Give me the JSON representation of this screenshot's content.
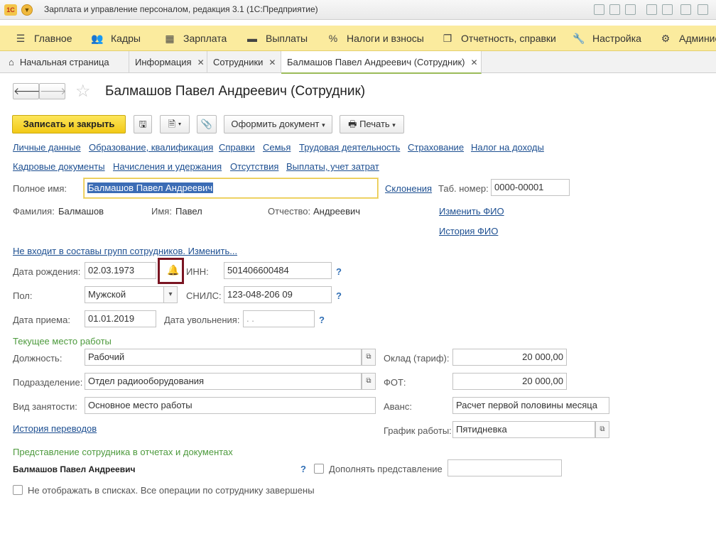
{
  "window": {
    "logo": "1С",
    "title": "Зарплата и управление персоналом, редакция 3.1  (1С:Предприятие)"
  },
  "main_menu": [
    {
      "icon": "hamburger-icon",
      "label": "Главное"
    },
    {
      "icon": "people-icon",
      "label": "Кадры"
    },
    {
      "icon": "calculator-icon",
      "label": "Зарплата"
    },
    {
      "icon": "wallet-icon",
      "label": "Выплаты"
    },
    {
      "icon": "percent-icon",
      "label": "Налоги и взносы"
    },
    {
      "icon": "reports-icon",
      "label": "Отчетность, справки"
    },
    {
      "icon": "wrench-icon",
      "label": "Настройка"
    },
    {
      "icon": "gear-icon",
      "label": "Админис"
    }
  ],
  "tabs": [
    {
      "label": "Начальная страница"
    },
    {
      "label": "Информация",
      "close": "✕"
    },
    {
      "label": "Сотрудники",
      "close": "✕"
    },
    {
      "label": "Балмашов Павел Андреевич (Сотрудник)",
      "close": "✕"
    }
  ],
  "form": {
    "title": "Балмашов Павел Андреевич (Сотрудник)",
    "toolbar": {
      "save_close": "Записать и закрыть",
      "create_document": "Оформить документ",
      "print": "Печать"
    },
    "links_row1": [
      "Личные данные",
      "Образование, квалификация",
      "Справки",
      "Семья",
      "Трудовая деятельность",
      "Страхование",
      "Налог на доходы"
    ],
    "links_row2": [
      "Кадровые документы",
      "Начисления и удержания",
      "Отсутствия",
      "Выплаты, учет затрат"
    ],
    "full_name": {
      "label": "Полное имя:",
      "value": "Балмашов Павел Андреевич",
      "declension_link": "Склонения"
    },
    "tab_number": {
      "label": "Таб. номер:",
      "value": "0000-00001"
    },
    "surname": {
      "label": "Фамилия:",
      "value": "Балмашов"
    },
    "name": {
      "label": "Имя:",
      "value": "Павел"
    },
    "patronymic": {
      "label": "Отчество:",
      "value": "Андреевич"
    },
    "change_fio": "Изменить ФИО",
    "fio_history": "История ФИО",
    "groups_link": "Не входит в составы групп сотрудников. Изменить...",
    "birth_date": {
      "label": "Дата рождения:",
      "value": "02.03.1973"
    },
    "inn": {
      "label": "ИНН:",
      "value": "501406600484"
    },
    "gender": {
      "label": "Пол:",
      "value": "Мужской"
    },
    "snils": {
      "label": "СНИЛС:",
      "value": "123-048-206 09"
    },
    "hire_date": {
      "label": "Дата приема:",
      "value": "01.01.2019"
    },
    "dismissal_date": {
      "label": "Дата увольнения:",
      "value": " .  ."
    },
    "help_mark": "?",
    "current_job_section": "Текущее место работы",
    "position": {
      "label": "Должность:",
      "value": "Рабочий"
    },
    "department": {
      "label": "Подразделение:",
      "value": "Отдел радиооборудования"
    },
    "employment_type": {
      "label": "Вид занятости:",
      "value": "Основное место работы"
    },
    "salary": {
      "label": "Оклад (тариф):",
      "value": "20 000,00"
    },
    "fot": {
      "label": "ФОТ:",
      "value": "20 000,00"
    },
    "advance": {
      "label": "Аванс:",
      "value": "Расчет первой половины месяца"
    },
    "schedule": {
      "label": "График работы:",
      "value": "Пятидневка"
    },
    "transfer_history": "История переводов",
    "representation_section": "Представление сотрудника в отчетах и документах",
    "representation_value": "Балмашов Павел Андреевич",
    "supplement_label": "Дополнять представление",
    "hide_in_lists_label": "Не отображать в списках. Все операции по сотруднику завершены"
  }
}
